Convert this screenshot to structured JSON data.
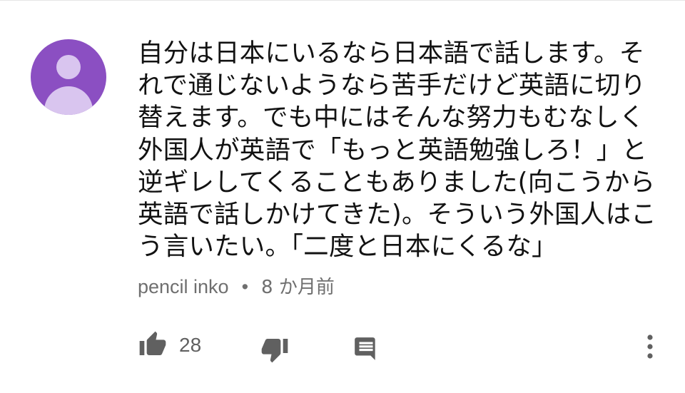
{
  "comment": {
    "text": "自分は日本にいるなら日本語で話します。そ\nれで通じないようなら苦手だけど英語に切り\n替えます。でも中にはそんな努力もむなしく\n外国人が英語で「もっと英語勉強しろ！」と\n逆ギレしてくることもありました(向こうから\n英語で話しかけてきた)。そういう外国人はこ\nう言いたい。「二度と日本にくるな」",
    "author": "pencil inko",
    "separator": "•",
    "age": "8 か月前",
    "likes": "28"
  },
  "icons": {
    "avatar": "default-avatar-icon",
    "like": "thumb-up-icon",
    "dislike": "thumb-down-icon",
    "reply": "reply-comment-icon",
    "more": "more-vertical-icon"
  },
  "colors": {
    "avatar_bg": "#8b4fc2",
    "avatar_fg": "#d9c5ef",
    "text": "#121212",
    "secondary_text": "#6f6f6f",
    "icon": "#606060"
  }
}
